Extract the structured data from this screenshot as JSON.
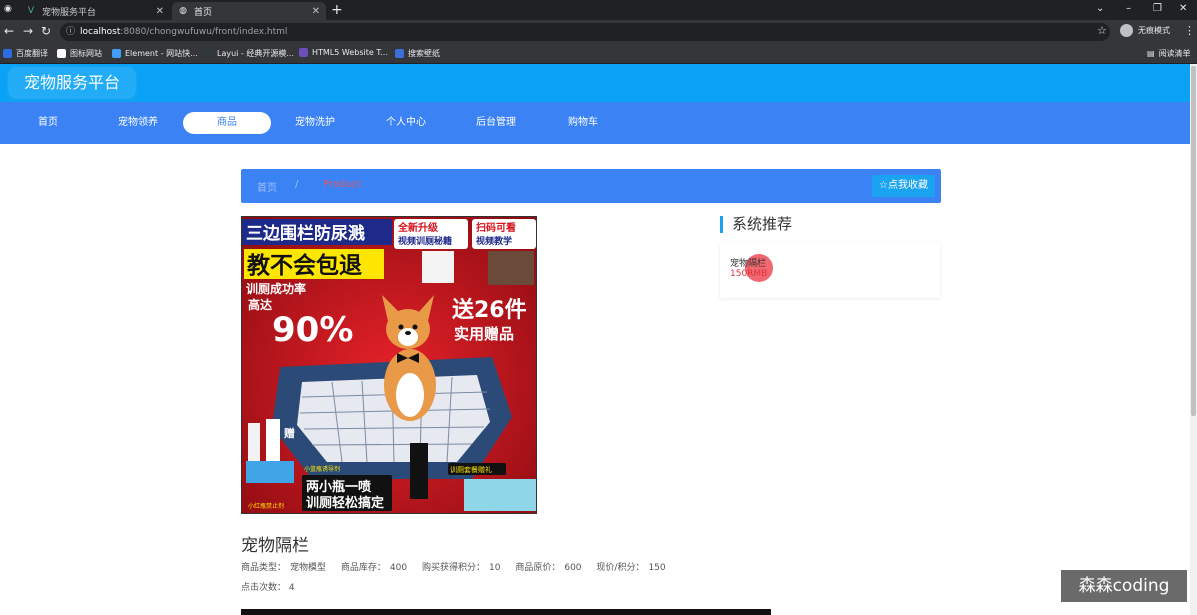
{
  "browser": {
    "tabs": [
      {
        "title": "宠物服务平台",
        "active": false
      },
      {
        "title": "首页",
        "active": true
      }
    ],
    "url_host": "localhost",
    "url_rest": ":8080/chongwufuwu/front/index.html",
    "profile_label": "无痕模式",
    "bookmarks": [
      {
        "label": "百度翻译",
        "color": "#2b6de0"
      },
      {
        "label": "图标网站",
        "color": "#ffffff"
      },
      {
        "label": "Element - 网站快...",
        "color": "#409eff"
      },
      {
        "label": "Layui - 经典开源模...",
        "color": "#2f363c"
      },
      {
        "label": "HTML5 Website T...",
        "color": "#6b4fbb"
      },
      {
        "label": "搜索壁纸",
        "color": "#3d6fd9"
      }
    ],
    "reading_list": "阅读清单"
  },
  "site": {
    "brand": "宠物服务平台",
    "nav": [
      "首页",
      "宠物领养",
      "商品",
      "宠物洗护",
      "个人中心",
      "后台管理",
      "购物车"
    ],
    "active_nav": 2
  },
  "breadcrumb": {
    "home": "首页",
    "separator": "/",
    "current": "Product"
  },
  "favorite_button": "☆点我收藏",
  "product_image": {
    "headline_1": "三边围栏防尿溅",
    "headline_2": "教不会包退",
    "badge_1": "全新升级",
    "badge_1b": "视频训厕秘籍",
    "badge_2": "扫码可看",
    "badge_2b": "视频教学",
    "rate_label_1": "训厕成功率",
    "rate_label_2": "高达",
    "rate_value": "90%",
    "gift_label": "送26件",
    "gift_sub": "实用赠品",
    "gift_tag": "赠",
    "spray_1": "小蓝瓶诱导剂",
    "spray_2": "小红瓶禁止剂",
    "slogan_1": "两小瓶一喷",
    "slogan_2": "训厕轻松搞定",
    "set_label": "训厕套餐赠礼"
  },
  "recommend": {
    "title": "系统推荐",
    "items": [
      {
        "name": "宠物隔栏",
        "price": "150RMB"
      }
    ]
  },
  "product": {
    "name": "宠物隔栏",
    "meta": [
      {
        "label": "商品类型：",
        "value": "宠物模型"
      },
      {
        "label": "商品库存：",
        "value": "400"
      },
      {
        "label": "购买获得积分：",
        "value": "10"
      },
      {
        "label": "商品原价：",
        "value": "600"
      },
      {
        "label": "现价/积分：",
        "value": "150"
      }
    ],
    "clicks_label": "点击次数：",
    "clicks_value": "4"
  },
  "watermark": "森森coding",
  "colors": {
    "site_top": "#0aa2f5",
    "nav": "#3b82f5",
    "accent": "#1aa3f0",
    "price": "#e0323d"
  }
}
